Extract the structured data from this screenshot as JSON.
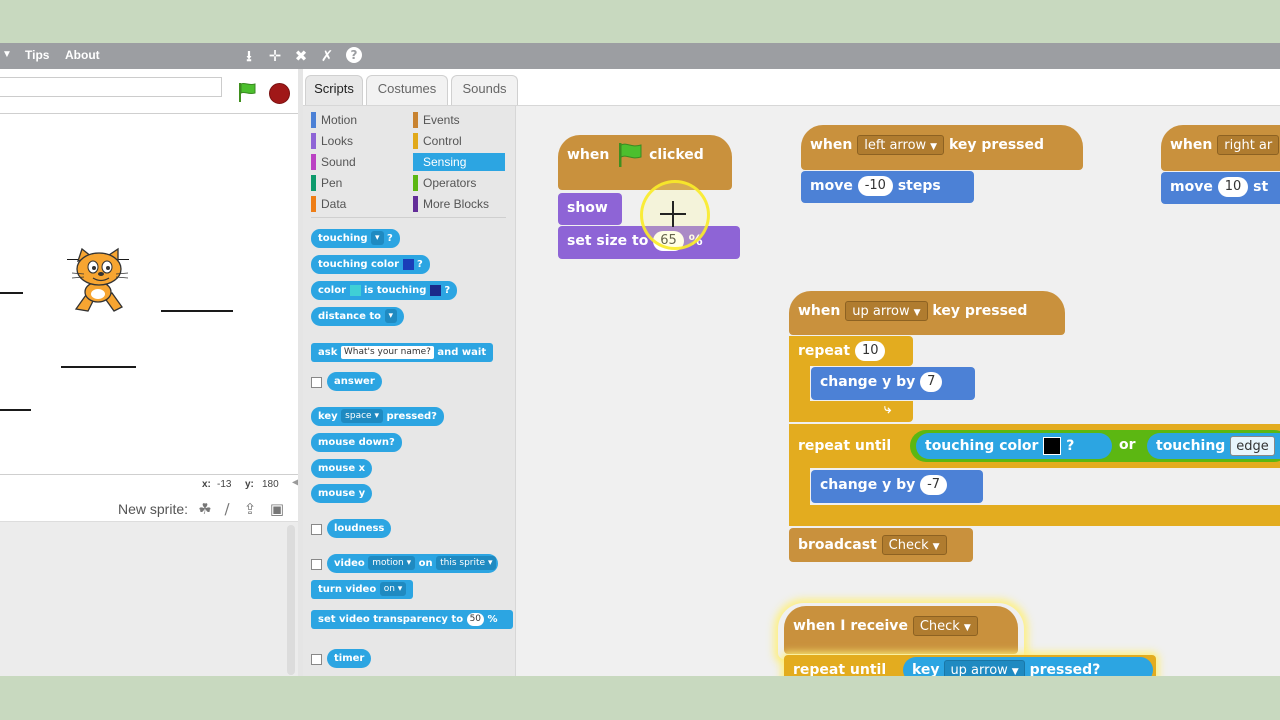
{
  "menubar": {
    "arrow": "▼",
    "tips": "Tips",
    "about": "About",
    "icons": [
      "stamp-icon",
      "grow-icon",
      "shrink-icon",
      "expand-icon",
      "help-icon"
    ]
  },
  "stage": {
    "x_label": "x:",
    "x_value": "-13",
    "y_label": "y:",
    "y_value": "180"
  },
  "sprite_pane": {
    "new_sprite_label": "New sprite:"
  },
  "tabs": [
    "Scripts",
    "Costumes",
    "Sounds"
  ],
  "categories": {
    "left": [
      "Motion",
      "Looks",
      "Sound",
      "Pen",
      "Data"
    ],
    "right": [
      "Events",
      "Control",
      "Sensing",
      "Operators",
      "More Blocks"
    ],
    "selected": "Sensing"
  },
  "palette": {
    "touching": "touching",
    "touching_color": "touching color",
    "q": "?",
    "color": "color",
    "is_touching": "is touching",
    "distance_to": "distance to",
    "ask": "ask",
    "ask_text": "What's your name?",
    "and_wait": "and wait",
    "answer": "answer",
    "key": "key",
    "key_value": "space",
    "pressed": "pressed?",
    "mouse_down": "mouse down?",
    "mouse_x": "mouse x",
    "mouse_y": "mouse y",
    "loudness": "loudness",
    "video": "video",
    "video_motion": "motion",
    "on": "on",
    "this_sprite": "this sprite",
    "turn_video": "turn video",
    "turn_video_value": "on",
    "set_video_transparency": "set video transparency to",
    "transparency_value": "50",
    "percent": "%",
    "timer": "timer"
  },
  "scripts": {
    "flag_script": {
      "when": "when",
      "clicked": "clicked",
      "show": "show",
      "set_size": "set size to",
      "size_value": "65",
      "percent": "%"
    },
    "left_script": {
      "when": "when",
      "key": "left arrow",
      "key_pressed": "key pressed",
      "move": "move",
      "move_value": "-10",
      "steps": "steps"
    },
    "right_script": {
      "when": "when",
      "key": "right ar",
      "move": "move",
      "move_value": "10",
      "steps": "st"
    },
    "up_script": {
      "when": "when",
      "key": "up arrow",
      "key_pressed": "key pressed",
      "repeat": "repeat",
      "repeat_value": "10",
      "change_y": "change y by",
      "change_value_1": "7",
      "repeat_until": "repeat until",
      "touching_color": "touching color",
      "q": "?",
      "or": "or",
      "touching": "touching",
      "touching_value": "edge",
      "change_value_2": "-7",
      "broadcast": "broadcast",
      "broadcast_value": "Check"
    },
    "receive_script": {
      "when_i_receive": "when I receive",
      "receive_value": "Check",
      "repeat_until": "repeat until",
      "key": "key",
      "key_value": "up arrow",
      "pressed": "pressed?"
    }
  },
  "colors": {
    "events": "#c9913d",
    "motion": "#4c81d6",
    "looks": "#8e64d6",
    "control": "#e3ac1f",
    "sensing": "#2ca5e2",
    "operators": "#5cb712"
  }
}
